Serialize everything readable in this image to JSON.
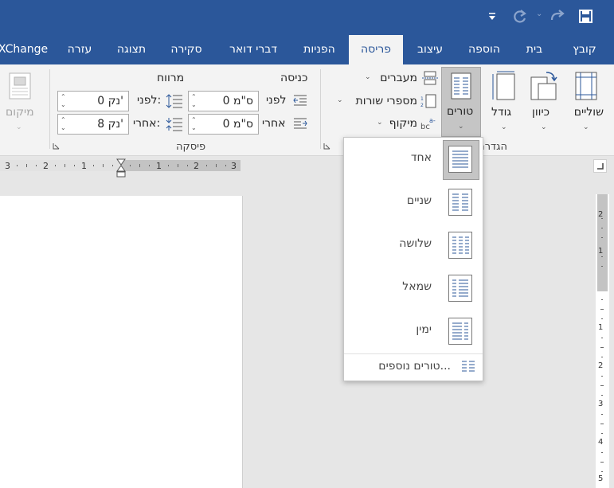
{
  "titlebar": {
    "bg": "#2b579a"
  },
  "tabs": [
    {
      "label": "קובץ"
    },
    {
      "label": "בית"
    },
    {
      "label": "הוספה"
    },
    {
      "label": "עיצוב"
    },
    {
      "label": "פריסה"
    },
    {
      "label": "הפניות"
    },
    {
      "label": "דברי דואר"
    },
    {
      "label": "סקירה"
    },
    {
      "label": "תצוגה"
    },
    {
      "label": "עזרה"
    },
    {
      "label": "XChange"
    }
  ],
  "ribbon": {
    "margins_label": "שוליים",
    "orientation_label": "כיוון",
    "size_label": "גודל",
    "columns_label": "טורים",
    "breaks_label": "מעברים",
    "line_numbers_label": "מספרי שורות",
    "hyphenation_label": "מיקוף",
    "page_setup_group": "הגדרת",
    "indent_heading": "כניסה",
    "spacing_heading": "מרווח",
    "indent_before_label": "לפני",
    "indent_after_label": "אחרי",
    "indent_before_value": "0 ס\"מ",
    "indent_after_value": "0 ס\"מ",
    "spacing_before_label": "לפני:",
    "spacing_after_label": "אחרי:",
    "spacing_before_value": "0 נק'",
    "spacing_after_value": "8 נק'",
    "paragraph_group": "פיסקה",
    "position_label": "מיקום"
  },
  "ruler": {
    "left_numbers": [
      "3",
      "2",
      "1"
    ],
    "right_numbers": [
      "1",
      "2",
      "3"
    ],
    "vertical_numbers": [
      "1",
      "2",
      "3",
      "4",
      "5"
    ],
    "vertical_top_numbers": [
      "2",
      "1"
    ]
  },
  "columns_menu": {
    "options": [
      {
        "label": "אחד",
        "selected": true
      },
      {
        "label": "שניים",
        "selected": false
      },
      {
        "label": "שלושה",
        "selected": false
      },
      {
        "label": "שמאל",
        "selected": false
      },
      {
        "label": "ימין",
        "selected": false
      }
    ],
    "more_label": "טורים נוספים..."
  }
}
